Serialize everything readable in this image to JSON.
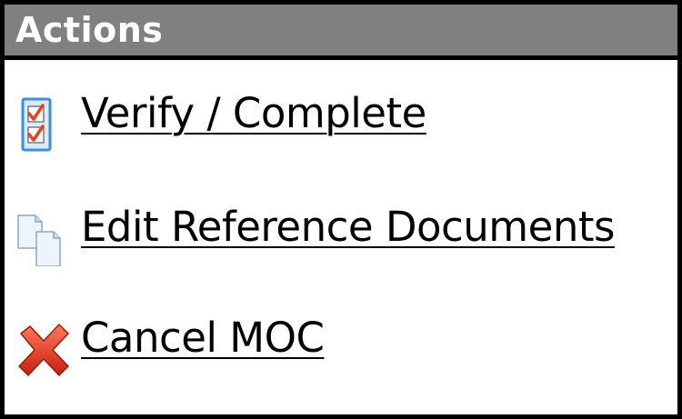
{
  "panel": {
    "title": "Actions"
  },
  "actions": [
    {
      "label": "Verify / Complete",
      "icon": "checklist-icon"
    },
    {
      "label": "Edit Reference Documents",
      "icon": "documents-icon"
    },
    {
      "label": "Cancel MOC",
      "icon": "cancel-x-icon"
    }
  ],
  "colors": {
    "header_bg": "#808080",
    "header_text": "#ffffff",
    "border": "#000000",
    "check_red": "#e8401c",
    "checklist_frame": "#3a8fd8",
    "cancel_red": "#e0301e"
  }
}
